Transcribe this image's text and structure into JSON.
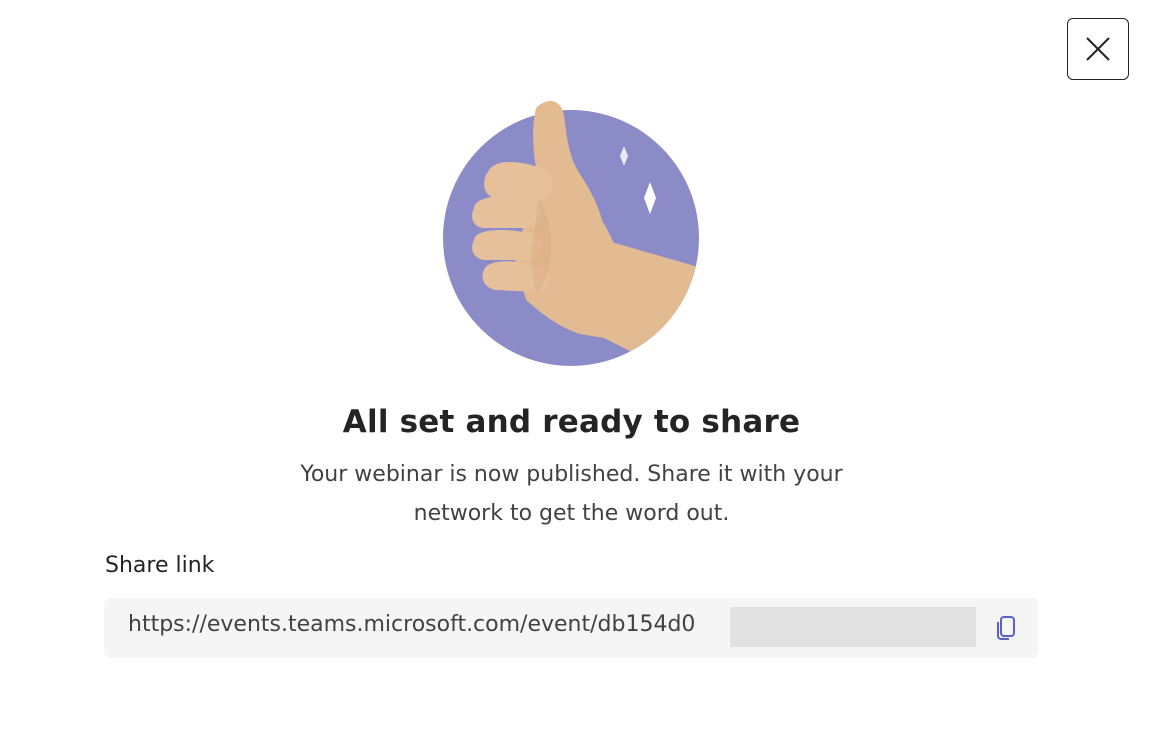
{
  "dialog": {
    "close_label": "Close",
    "title": "All set and ready to share",
    "subtitle_line1": "Your webinar is now published. Share it with your",
    "subtitle_line2": "network to get the word out.",
    "share_label": "Share link",
    "share_url": "https://events.teams.microsoft.com/event/db154d0",
    "copy_label": "Copy link"
  },
  "colors": {
    "accent": "#5b5fc7",
    "illustration_circle": "#8b8cc7",
    "hand": "#e3bb93",
    "field_background": "#f5f5f5"
  },
  "icons": {
    "close": "close-icon",
    "copy": "copy-icon",
    "illustration": "thumbs-up-illustration"
  }
}
